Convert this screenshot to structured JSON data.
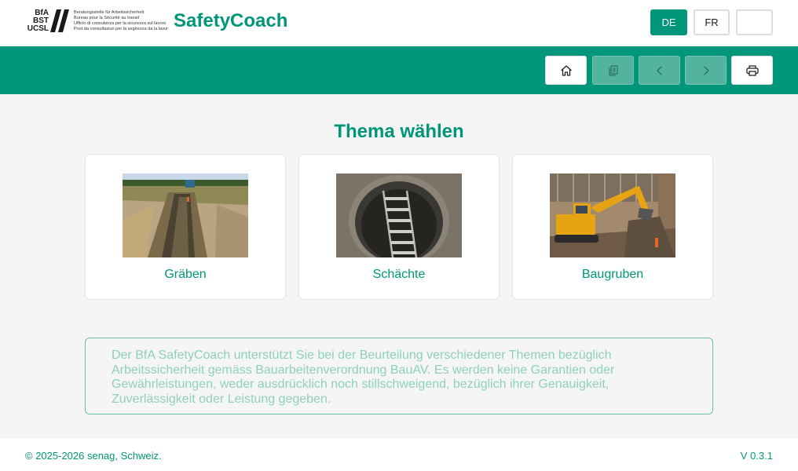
{
  "header": {
    "logo": {
      "abbreviations": [
        "BfA",
        "BST",
        "UCSL"
      ],
      "lines": [
        "Beratungsstelle für Arbeitssicherheit",
        "Bureau pour la Sécurité au travail",
        "Ufficio di consulenza per la sicurezza sul lavoro",
        "Post da consultaziun per la segirezza da la lavur"
      ]
    },
    "app_name": "SafetyCoach",
    "languages": [
      {
        "label": "DE",
        "active": true
      },
      {
        "label": "FR",
        "active": false
      },
      {
        "label": "",
        "active": false
      }
    ]
  },
  "toolbar": {
    "buttons": [
      {
        "icon": "home-icon",
        "enabled": true
      },
      {
        "icon": "copy-icon",
        "enabled": false
      },
      {
        "icon": "chevron-left-icon",
        "enabled": false
      },
      {
        "icon": "chevron-right-icon",
        "enabled": false
      },
      {
        "icon": "printer-icon",
        "enabled": true
      }
    ]
  },
  "main": {
    "title": "Thema wählen",
    "topics": [
      {
        "label": "Gräben",
        "image": "trench-photo"
      },
      {
        "label": "Schächte",
        "image": "manhole-shaft-photo"
      },
      {
        "label": "Baugruben",
        "image": "excavation-pit-photo"
      }
    ],
    "disclaimer": "Der BfA SafetyCoach unterstützt Sie bei der Beurteilung verschiedener Themen bezüglich Arbeitssicherheit gemäss Bauarbeitenverordnung BauAV. Es werden keine Garantien oder Gewährleistungen, weder ausdrücklich noch stillschweigend, bezüglich ihrer Genauigkeit, Zuverlässigkeit oder Leistung gegeben."
  },
  "footer": {
    "copyright": "© 2025-2026 senag, Schweiz.",
    "version": "V 0.3.1"
  },
  "colors": {
    "primary": "#00967a",
    "primary_disabled": "#53b39f",
    "disclaimer_text": "#8ed0c0",
    "page_background": "#f5f5f5"
  }
}
